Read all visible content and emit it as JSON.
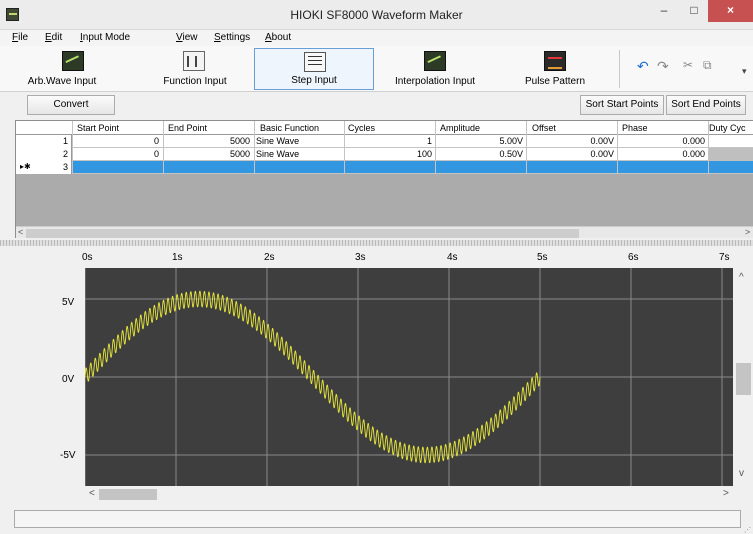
{
  "window": {
    "title": "HIOKI SF8000 Waveform Maker",
    "minimize_glyph": "–",
    "maximize_glyph": "□",
    "close_glyph": "×"
  },
  "menu": {
    "items": [
      {
        "label": "File"
      },
      {
        "label": "Edit"
      },
      {
        "label": "Input Mode"
      },
      {
        "label": "View"
      },
      {
        "label": "Settings"
      },
      {
        "label": "About"
      }
    ]
  },
  "toolbar": {
    "buttons": [
      {
        "label": "Arb.Wave Input",
        "icon": "arb-wave-icon"
      },
      {
        "label": "Function Input",
        "icon": "function-icon"
      },
      {
        "label": "Step Input",
        "icon": "step-icon",
        "active": true
      },
      {
        "label": "Interpolation Input",
        "icon": "interpolation-icon"
      },
      {
        "label": "Pulse Pattern",
        "icon": "pulse-icon"
      }
    ],
    "undo_glyph": "↶",
    "redo_glyph": "↷",
    "cut_glyph": "✂",
    "copy_glyph": "⧉",
    "overflow_glyph": "▾"
  },
  "commands": {
    "convert": "Convert",
    "sort_start": "Sort Start Points",
    "sort_end": "Sort End Points"
  },
  "grid": {
    "columns": [
      "Start Point",
      "End Point",
      "Basic Function",
      "Cycles",
      "Amplitude",
      "Offset",
      "Phase",
      "Duty Cyc"
    ],
    "rows": [
      {
        "index": "1",
        "start": "0",
        "end": "5000",
        "function": "Sine Wave",
        "cycles": "1",
        "amplitude": "5.00V",
        "offset": "0.00V",
        "phase": "0.000"
      },
      {
        "index": "2",
        "start": "0",
        "end": "5000",
        "function": "Sine Wave",
        "cycles": "100",
        "amplitude": "0.50V",
        "offset": "0.00V",
        "phase": "0.000"
      },
      {
        "index": "3",
        "marker": "▸✱"
      }
    ],
    "scroll_left": "<",
    "scroll_right": ">"
  },
  "waveform": {
    "x_ticks": [
      "0s",
      "1s",
      "2s",
      "3s",
      "4s",
      "5s",
      "6s",
      "7s"
    ],
    "y_ticks": [
      "5V",
      "0V",
      "-5V"
    ],
    "trace_color": "#e8e83a",
    "background_color": "#3e3e3e",
    "grid_color": "#8a8a8a",
    "scroll_up": "^",
    "scroll_down": "v",
    "scroll_left": "<",
    "scroll_right": ">"
  },
  "status": {
    "text": "",
    "grip": "⋰"
  }
}
